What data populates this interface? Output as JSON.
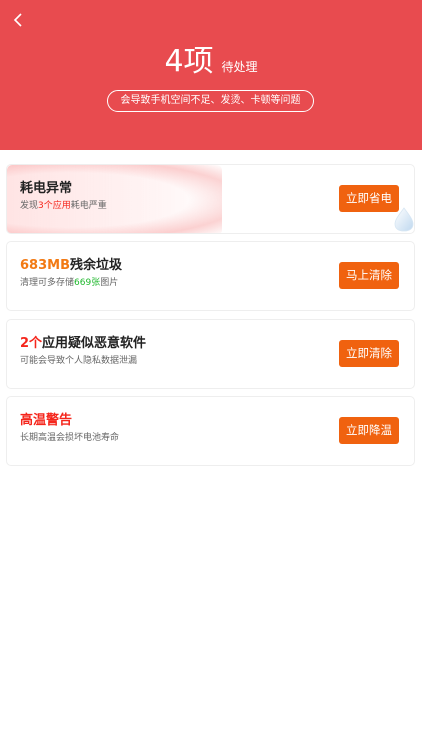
{
  "header": {
    "count": "4",
    "unit": "项",
    "label": "待处理",
    "warning": "会导致手机空间不足、发烫、卡顿等问题"
  },
  "cards": [
    {
      "title_parts": [
        "耗电异常"
      ],
      "sub_prefix": "发现",
      "sub_highlight": "3个应用",
      "sub_suffix": "耗电严重",
      "button": "立即省电"
    },
    {
      "title_highlight": "683MB",
      "title_rest": "残余垃圾",
      "sub_prefix": "清理可多存储",
      "sub_highlight": "669张",
      "sub_suffix": "图片",
      "button": "马上清除"
    },
    {
      "title_highlight": "2个",
      "title_rest": "应用疑似恶意软件",
      "sub": "可能会导致个人隐私数据泄漏",
      "button": "立即清除"
    },
    {
      "title_highlight": "高温警告",
      "sub": "长期高温会损坏电池寿命",
      "button": "立即降温"
    }
  ],
  "colors": {
    "header_bg": "#e84b4f",
    "button_bg": "#f0620f",
    "highlight_orange": "#f27a14",
    "highlight_red": "#f5261c",
    "highlight_green": "#1fb82d"
  },
  "icons": {
    "back": "chevron-left-icon",
    "bubble": "water-drop-icon"
  }
}
